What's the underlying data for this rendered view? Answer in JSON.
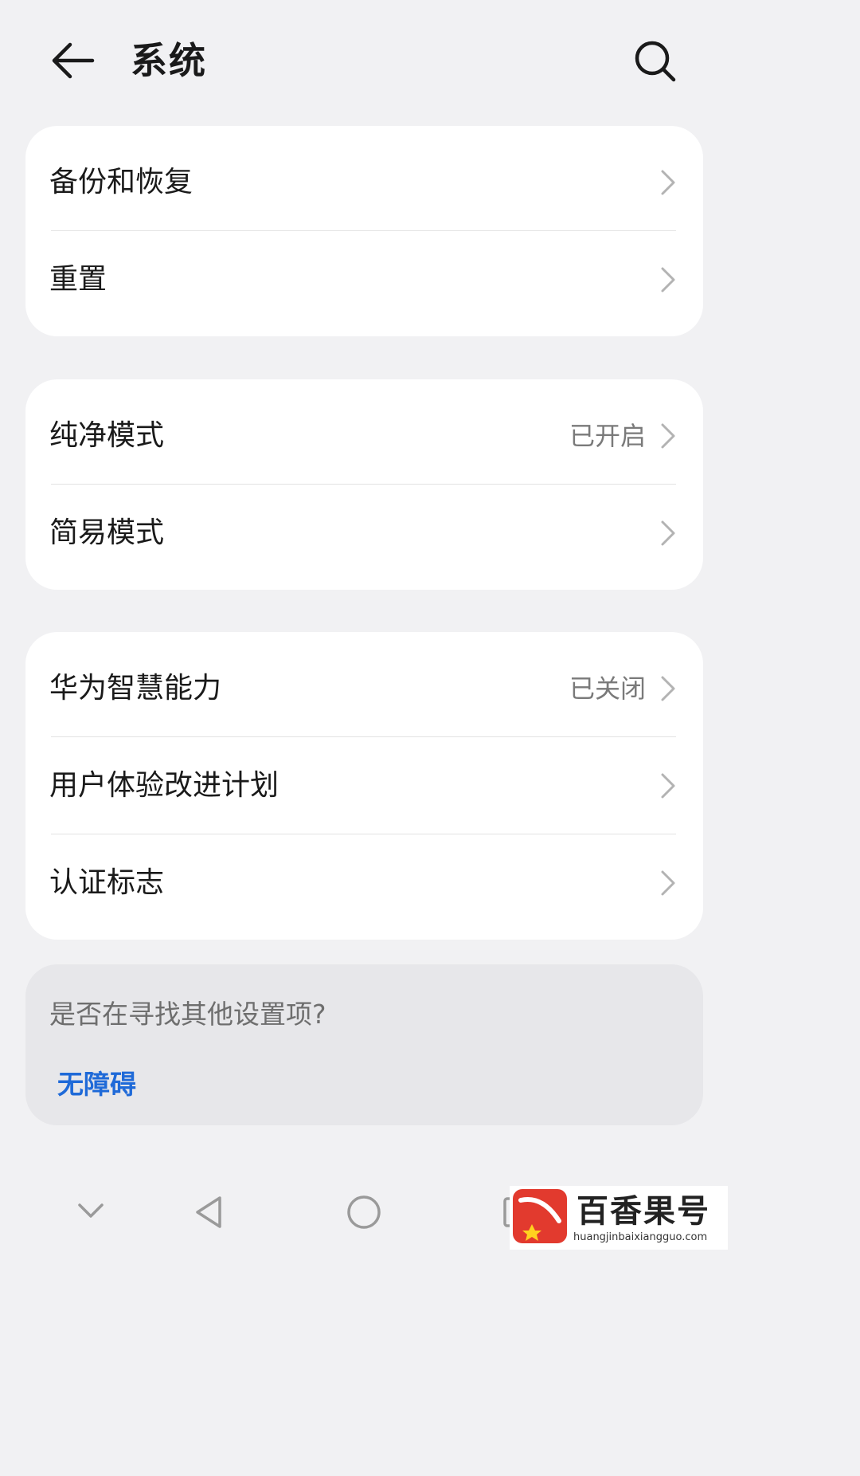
{
  "header": {
    "title": "系统",
    "back_icon": "arrow-left-icon",
    "search_icon": "search-icon"
  },
  "group1": [
    {
      "label": "备份和恢复"
    },
    {
      "label": "重置"
    }
  ],
  "group2": [
    {
      "label": "纯净模式",
      "value": "已开启"
    },
    {
      "label": "简易模式"
    }
  ],
  "group3": [
    {
      "label": "华为智慧能力",
      "value": "已关闭"
    },
    {
      "label": "用户体验改进计划"
    },
    {
      "label": "认证标志"
    }
  ],
  "hint": {
    "text": "是否在寻找其他设置项?",
    "link": "无障碍"
  },
  "navbar": {
    "icons": [
      "chevron-down-icon",
      "back-triangle-icon",
      "home-circle-icon",
      "recents-square-icon"
    ]
  },
  "watermark": {
    "name": "百香果号",
    "url": "huangjinbaixiangguo.com"
  },
  "colors": {
    "background": "#f1f1f3",
    "card": "#ffffff",
    "link": "#1f6ad8",
    "secondary_text": "#7a7a7a"
  }
}
